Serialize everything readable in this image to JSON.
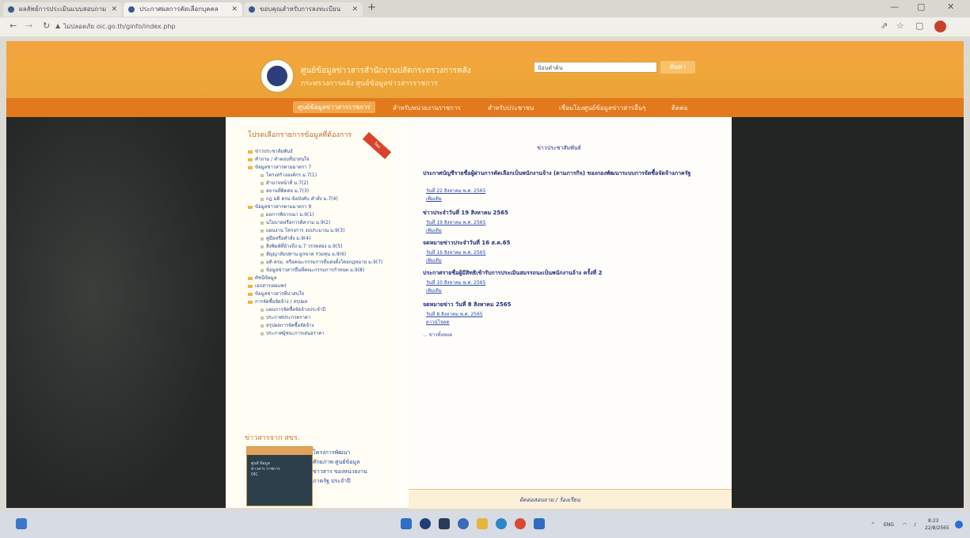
{
  "browser": {
    "tabs": [
      {
        "label": "ผลลัพธ์การประเมินแบบสอบถาม",
        "active": false
      },
      {
        "label": "ประกาศผลการคัดเลือกบุคคล",
        "active": true
      },
      {
        "label": "ขอบคุณสำหรับการลงทะเบียน",
        "active": false
      }
    ],
    "new_tab": "+",
    "url": "ไม่ปลอดภัย  oic.go.th/ginfo/index.php",
    "window_controls": [
      "—",
      "▢",
      "✕"
    ]
  },
  "site": {
    "title": "ศูนย์ข้อมูลข่าวสารสำนักงานปลัดกระทรวงการคลัง",
    "subtitle": "กระทรวงการคลัง   ศูนย์ข้อมูลข่าวสารราชการ",
    "search_placeholder": "ป้อนคำค้น",
    "search_button": "ค้นหา"
  },
  "menu": [
    {
      "label": "ศูนย์ข้อมูลข่าวสารราชการ",
      "active": true
    },
    {
      "label": "สำหรับหน่วยงานราชการ",
      "active": false
    },
    {
      "label": "สำหรับประชาชน",
      "active": false
    },
    {
      "label": "เชื่อมโยงศูนย์ข้อมูลข่าวสารอื่นๆ",
      "active": false
    },
    {
      "label": "ติดต่อ",
      "active": false
    }
  ],
  "sidebar": {
    "heading": "โปรดเลือกรายการข้อมูลที่ต้องการ",
    "ribbon": "ใหม่",
    "items": [
      {
        "label": "ข่าวประชาสัมพันธ์",
        "level": 0
      },
      {
        "label": "คำถาม / คำตอบที่น่าสนใจ",
        "level": 0
      },
      {
        "label": "ข้อมูลข่าวสารตามมาตรา 7",
        "level": 0
      },
      {
        "label": "โครงสร้างองค์กร ม.7(1)",
        "level": 1
      },
      {
        "label": "อำนาจหน้าที่ ม.7(2)",
        "level": 1
      },
      {
        "label": "สถานที่ติดต่อ ม.7(3)",
        "level": 1
      },
      {
        "label": "กฎ มติ ครม.ข้อบังคับ คำสั่ง ม.7(4)",
        "level": 1
      },
      {
        "label": "ข้อมูลข่าวสารตามมาตรา 9",
        "level": 0
      },
      {
        "label": "ผลการพิจารณา ม.9(1)",
        "level": 1
      },
      {
        "label": "นโยบายหรือการตีความ ม.9(2)",
        "level": 1
      },
      {
        "label": "แผนงาน โครงการ งบประมาณ ม.9(3)",
        "level": 1
      },
      {
        "label": "คู่มือหรือคำสั่ง ม.9(4)",
        "level": 1
      },
      {
        "label": "สิ่งพิมพ์ที่อ้างถึง ม.7 วรรคสอง ม.9(5)",
        "level": 1
      },
      {
        "label": "สัญญาสัมปทาน ผูกขาด ร่วมทุน ม.9(6)",
        "level": 1
      },
      {
        "label": "มติ ครม. หรือคณะกรรมการที่แต่งตั้งโดยกฎหมาย ม.9(7)",
        "level": 1
      },
      {
        "label": "ข้อมูลข่าวสารอื่นที่คณะกรรมการกำหนด ม.9(8)",
        "level": 1
      },
      {
        "label": "ดัชนีข้อมูล",
        "level": 0
      },
      {
        "label": "เอกสารเผยแพร่",
        "level": 0
      },
      {
        "label": "ข้อมูลข่าวสารที่น่าสนใจ",
        "level": 0
      },
      {
        "label": "การจัดซื้อจัดจ้าง / สรุปผล",
        "level": 0
      },
      {
        "label": "แผนการจัดซื้อจัดจ้างประจำปี",
        "level": 1
      },
      {
        "label": "ประกาศประกวดราคา",
        "level": 1
      },
      {
        "label": "สรุปผลการจัดซื้อจัดจ้าง",
        "level": 1
      },
      {
        "label": "ประกาศผู้ชนะการเสนอราคา",
        "level": 1
      }
    ],
    "news_heading": "ข่าวสารจาก สขร.",
    "news_image_text": "ศูนย์ ข้อมูล\nข่าวสาร ราชการ\nOIC",
    "news_text": "โครงการพัฒนาศักยภาพ ศูนย์ข้อมูลข่าวสาร ของหน่วยงานภาครัฐ ประจำปี"
  },
  "main": {
    "heading": "ข่าวประชาสัมพันธ์",
    "articles": [
      {
        "title": "ประกาศบัญชีรายชื่อผู้ผ่านการคัดเลือกเป็นพนักงานจ้าง (ตามภารกิจ) ของกองพัฒนาระบบการจัดซื้อจัดจ้างภาครัฐ",
        "date": "วันที่ 22 สิงหาคม พ.ศ. 2565",
        "more": "เพิ่มเติม"
      },
      {
        "title": "ข่าวประจำวันที่ 19 สิงหาคม 2565",
        "date": "วันที่ 19 สิงหาคม พ.ศ. 2565",
        "more": "เพิ่มเติม"
      },
      {
        "title": "จดหมายข่าวประจำวันที่ 16 ส.ค.65",
        "date": "วันที่ 16 สิงหาคม พ.ศ. 2565",
        "more": "เพิ่มเติม"
      },
      {
        "title": "ประกาศรายชื่อผู้มีสิทธิเข้ารับการประเมินสมรรถนะเป็นพนักงานจ้าง ครั้งที่ 2",
        "date": "วันที่ 10 สิงหาคม พ.ศ. 2565",
        "more": "เพิ่มเติม"
      },
      {
        "title": "จดหมายข่าว วันที่ 8 สิงหาคม 2565",
        "date": "วันที่ 8 สิงหาคม พ.ศ. 2565",
        "more": "ดาวน์โหลด"
      }
    ],
    "all_link": "... ข่าวทั้งหมด",
    "footer": "ติดต่อสอบถาม / ร้องเรียน"
  },
  "taskbar": {
    "tray_lang": "ENG",
    "tray_time": "8:23",
    "tray_date": "22/8/2565"
  },
  "colors": {
    "header": "#f0a73a",
    "menubar": "#e2791c",
    "link": "#2a4aa8"
  }
}
